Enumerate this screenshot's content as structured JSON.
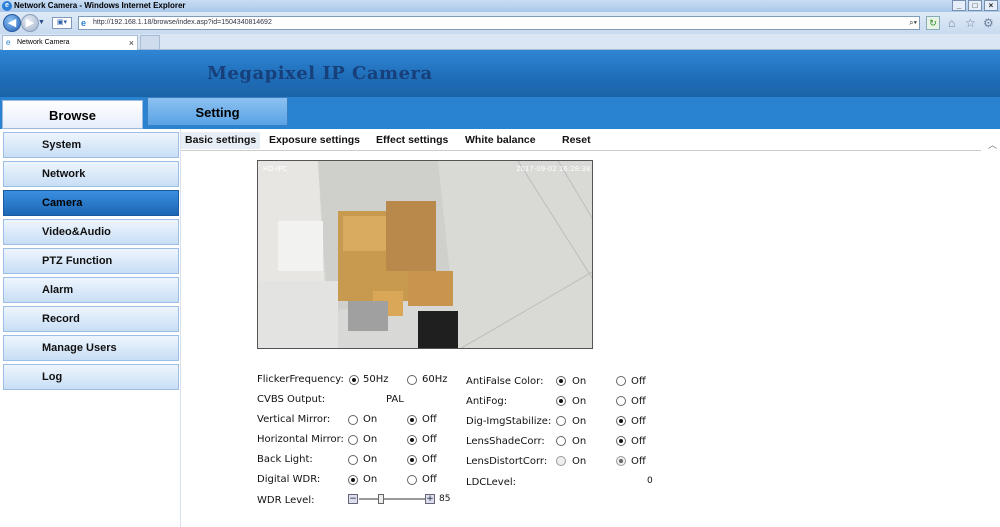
{
  "browser": {
    "window_title": "Network Camera - Windows Internet Explorer",
    "url": "http://192.168.1.18/browse/index.asp?id=1504340814692",
    "tab_label": "Network Camera",
    "tab_close": "×",
    "win_min": "_",
    "win_max": "□",
    "win_close": "×"
  },
  "app": {
    "brand": "Megapixel IP Camera",
    "main_tabs": [
      "Browse",
      "Setting"
    ],
    "sidebar": [
      "System",
      "Network",
      "Camera",
      "Video&Audio",
      "PTZ Function",
      "Alarm",
      "Record",
      "Manage Users",
      "Log"
    ],
    "active_sidebar": "Camera",
    "sub_tabs": [
      "Basic settings",
      "Exposure settings",
      "Effect settings",
      "White balance",
      "Reset"
    ],
    "active_sub_tab": "Basic settings"
  },
  "video": {
    "overlay_left": "HD-IPC",
    "timestamp": "2017-09-02   16:28:38"
  },
  "settings": {
    "flicker_label": "FlickerFrequency:",
    "flicker_opt1": "50Hz",
    "flicker_opt2": "60Hz",
    "flicker_value": "50Hz",
    "cvbs_label": "CVBS Output:",
    "cvbs_value": "PAL",
    "vmirror_label": "Vertical Mirror:",
    "hmirror_label": "Horizontal Mirror:",
    "backlight_label": "Back Light:",
    "dwdr_label": "Digital WDR:",
    "wdr_level_label": "WDR Level:",
    "wdr_level_value": "85",
    "wdr_level_fraction": 0.85,
    "antifalse_label": "AntiFalse Color:",
    "antifog_label": "AntiFog:",
    "digimg_label": "Dig-ImgStabilize:",
    "lensshade_label": "LensShadeCorr:",
    "lensdistort_label": "LensDistortCorr:",
    "ldclevel_label": "LDCLevel:",
    "ldclevel_value": "0",
    "on": "On",
    "off": "Off",
    "values": {
      "vertical_mirror": "Off",
      "horizontal_mirror": "Off",
      "back_light": "Off",
      "digital_wdr": "On",
      "antifalse_color": "On",
      "antifog": "On",
      "dig_img_stabilize": "Off",
      "lens_shade_corr": "Off",
      "lens_distort_corr": "Off"
    }
  },
  "colors": {
    "banner": "#1f6db8",
    "brand_text": "#173f79",
    "active_sidebar": "#1c66b5"
  }
}
